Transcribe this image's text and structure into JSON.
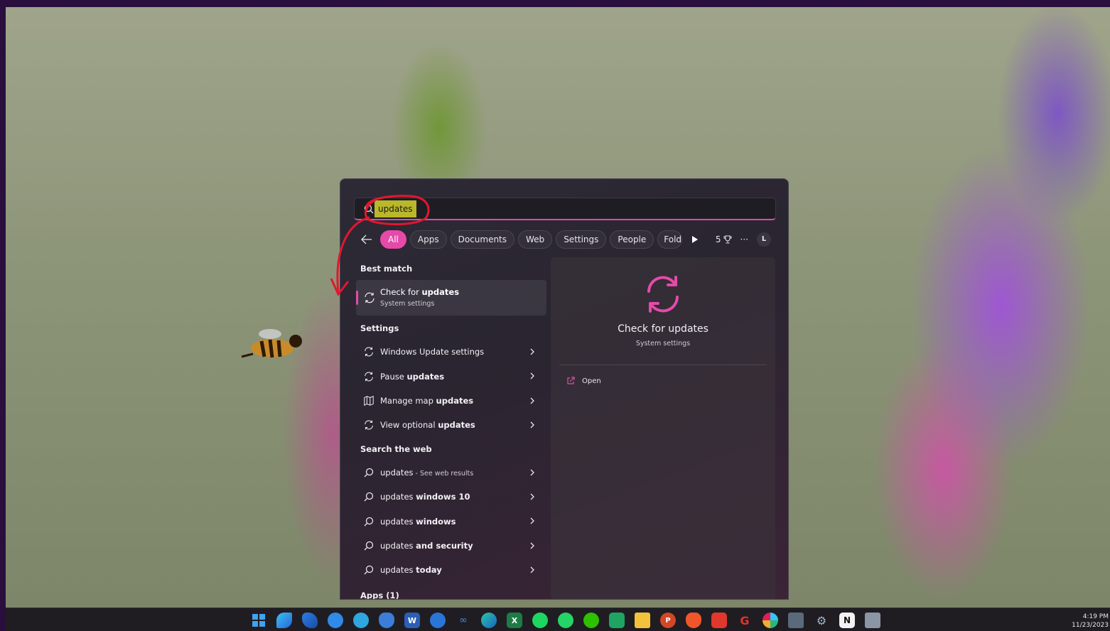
{
  "search": {
    "query": "updates"
  },
  "filters": {
    "tabs": [
      {
        "label": "All",
        "active": true
      },
      {
        "label": "Apps"
      },
      {
        "label": "Documents"
      },
      {
        "label": "Web"
      },
      {
        "label": "Settings"
      },
      {
        "label": "People"
      },
      {
        "label": "Folde"
      }
    ],
    "rewards_count": "5",
    "more_label": "···",
    "avatar_initial": "L"
  },
  "best_match": {
    "section_title": "Best match",
    "title_prefix": "Check for ",
    "title_bold": "updates",
    "subtitle": "System settings"
  },
  "settings": {
    "section_title": "Settings",
    "items": [
      {
        "prefix": "Windows Update settings",
        "bold": "",
        "icon": "sync-icon"
      },
      {
        "prefix": "Pause ",
        "bold": "updates",
        "icon": "sync-icon"
      },
      {
        "prefix": "Manage map ",
        "bold": "updates",
        "icon": "map-icon"
      },
      {
        "prefix": "View optional ",
        "bold": "updates",
        "icon": "sync-icon"
      }
    ]
  },
  "web": {
    "section_title": "Search the web",
    "items": [
      {
        "prefix": "updates",
        "bold": "",
        "suffix": " - See web results"
      },
      {
        "prefix": "updates ",
        "bold": "windows 10",
        "suffix": ""
      },
      {
        "prefix": "updates ",
        "bold": "windows",
        "suffix": ""
      },
      {
        "prefix": "updates ",
        "bold": "and security",
        "suffix": ""
      },
      {
        "prefix": "updates ",
        "bold": "today",
        "suffix": ""
      }
    ]
  },
  "apps": {
    "section_title": "Apps (1)"
  },
  "preview": {
    "title": "Check for updates",
    "subtitle": "System settings",
    "open_label": "Open"
  },
  "taskbar": {
    "time": "4:19 PM",
    "date": "11/23/2023",
    "icons": [
      "windows-start-icon",
      "copilot-icon",
      "arrow-app-icon",
      "blue-circle-app-icon",
      "telegram-icon",
      "shield-app-icon",
      "word-icon",
      "chat-app-icon",
      "infinity-app-icon",
      "edge-icon",
      "excel-icon",
      "spotify-icon",
      "whatsapp-icon",
      "wechat-icon",
      "green-app-icon",
      "file-explorer-icon",
      "powerpoint-icon",
      "brave-icon",
      "red-app-icon",
      "swirl-app-icon",
      "slack-icon",
      "calculator-icon",
      "settings-gear-icon",
      "notion-icon",
      "network-app-icon"
    ]
  },
  "colors": {
    "accent": "#e54aa9",
    "highlight": "#b9b72a",
    "annotation": "#e0182e",
    "panel": "#2a2530"
  }
}
